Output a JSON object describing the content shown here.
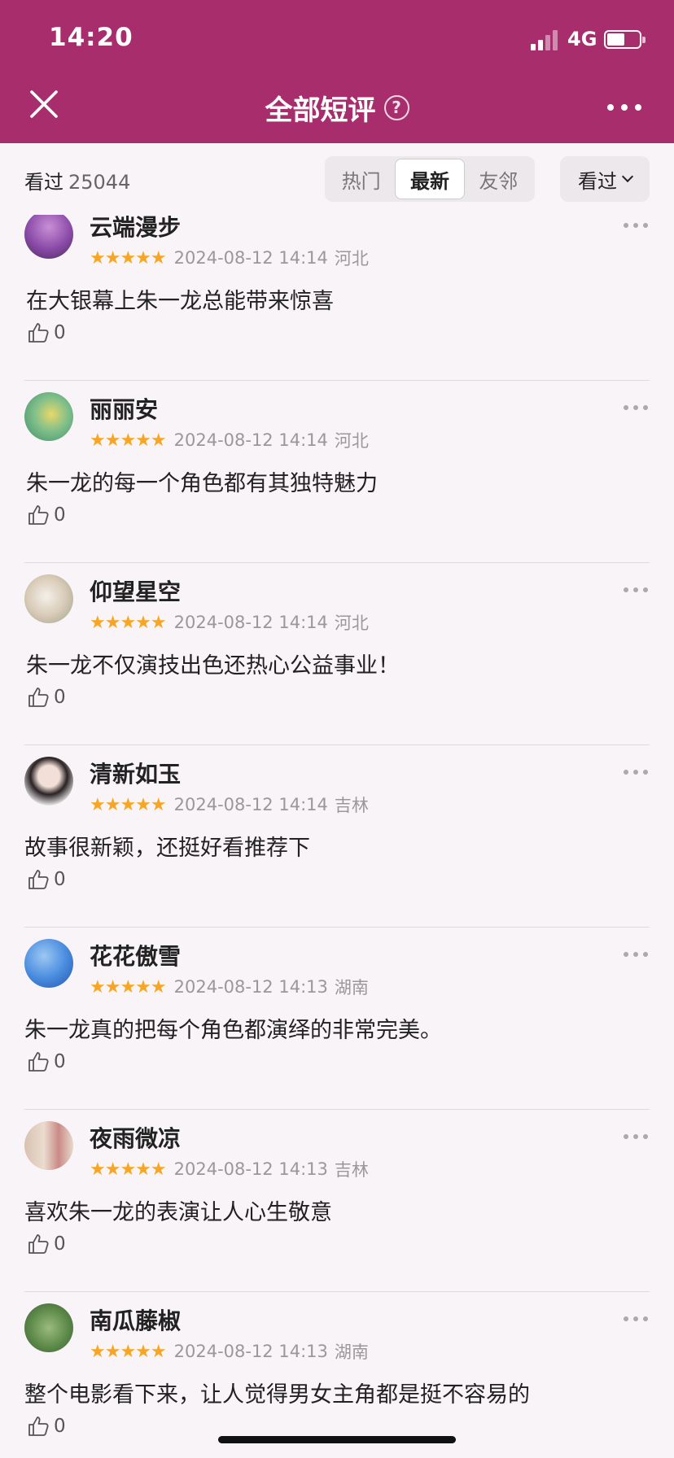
{
  "status": {
    "time": "14:20",
    "network": "4G"
  },
  "header": {
    "title": "全部短评",
    "help": "?"
  },
  "filter": {
    "watched_label": "看过",
    "watched_count": "25044",
    "tabs": [
      "热门",
      "最新",
      "友邻"
    ],
    "active_tab": "最新",
    "dropdown": "看过"
  },
  "reviews": [
    {
      "user": "云端漫步",
      "stars": 5,
      "stars_text": "★★★★★",
      "date": "2024-08-12 14:14",
      "location": "河北",
      "text": "在大银幕上朱一龙总能带来惊喜",
      "likes": "0"
    },
    {
      "user": "丽丽安",
      "stars": 5,
      "stars_text": "★★★★★",
      "date": "2024-08-12 14:14",
      "location": "河北",
      "text": "朱一龙的每一个角色都有其独特魅力",
      "likes": "0"
    },
    {
      "user": "仰望星空",
      "stars": 5,
      "stars_text": "★★★★★",
      "date": "2024-08-12 14:14",
      "location": "河北",
      "text": "朱一龙不仅演技出色还热心公益事业！",
      "likes": "0"
    },
    {
      "user": "清新如玉",
      "stars": 5,
      "stars_text": "★★★★★",
      "date": "2024-08-12 14:14",
      "location": "吉林",
      "text": "故事很新颖，还挺好看推荐下",
      "likes": "0"
    },
    {
      "user": "花花傲雪",
      "stars": 5,
      "stars_text": "★★★★★",
      "date": "2024-08-12 14:13",
      "location": "湖南",
      "text": "朱一龙真的把每个角色都演绎的非常完美。",
      "likes": "0"
    },
    {
      "user": "夜雨微凉",
      "stars": 5,
      "stars_text": "★★★★★",
      "date": "2024-08-12 14:13",
      "location": "吉林",
      "text": "喜欢朱一龙的表演让人心生敬意",
      "likes": "0"
    },
    {
      "user": "南瓜藤椒",
      "stars": 5,
      "stars_text": "★★★★★",
      "date": "2024-08-12 14:13",
      "location": "湖南",
      "text": "整个电影看下来，让人觉得男女主角都是挺不容易的",
      "likes": "0"
    }
  ],
  "colors": {
    "header_bg": "#a82d6c",
    "star": "#f7a624",
    "page_bg": "#f8f4f8"
  }
}
